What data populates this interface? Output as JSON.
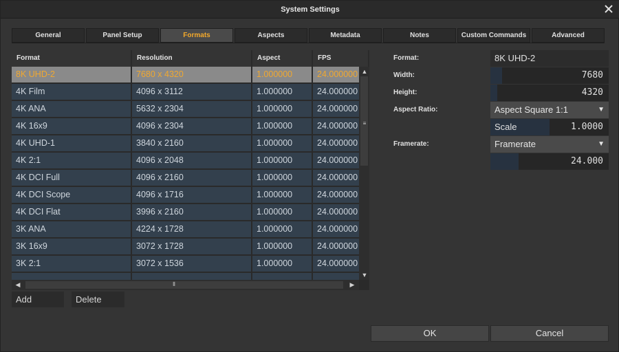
{
  "window": {
    "title": "System Settings"
  },
  "tabs": [
    {
      "label": "General",
      "active": false
    },
    {
      "label": "Panel Setup",
      "active": false
    },
    {
      "label": "Formats",
      "active": true
    },
    {
      "label": "Aspects",
      "active": false
    },
    {
      "label": "Metadata",
      "active": false
    },
    {
      "label": "Notes",
      "active": false
    },
    {
      "label": "Custom Commands",
      "active": false
    },
    {
      "label": "Advanced",
      "active": false
    }
  ],
  "table": {
    "columns": [
      "Format",
      "Resolution",
      "Aspect",
      "FPS"
    ],
    "selected_row": 0,
    "rows": [
      [
        "8K UHD-2",
        "7680 x 4320",
        "1.000000",
        "24.000000"
      ],
      [
        "4K Film",
        "4096 x 3112",
        "1.000000",
        "24.000000"
      ],
      [
        "4K ANA",
        "5632 x 2304",
        "1.000000",
        "24.000000"
      ],
      [
        "4K 16x9",
        "4096 x 2304",
        "1.000000",
        "24.000000"
      ],
      [
        "4K UHD-1",
        "3840 x 2160",
        "1.000000",
        "24.000000"
      ],
      [
        "4K 2:1",
        "4096 x 2048",
        "1.000000",
        "24.000000"
      ],
      [
        "4K DCI Full",
        "4096 x 2160",
        "1.000000",
        "24.000000"
      ],
      [
        "4K DCI Scope",
        "4096 x 1716",
        "1.000000",
        "24.000000"
      ],
      [
        "4K DCI Flat",
        "3996 x 2160",
        "1.000000",
        "24.000000"
      ],
      [
        "3K ANA",
        "4224 x 1728",
        "1.000000",
        "24.000000"
      ],
      [
        "3K 16x9",
        "3072 x 1728",
        "1.000000",
        "24.000000"
      ],
      [
        "3K 2:1",
        "3072 x 1536",
        "1.000000",
        "24.000000"
      ],
      [
        "",
        "",
        "",
        ""
      ]
    ]
  },
  "buttons": {
    "add": "Add",
    "delete": "Delete",
    "ok": "OK",
    "cancel": "Cancel"
  },
  "details": {
    "format_label": "Format:",
    "format_value": "8K UHD-2",
    "width_label": "Width:",
    "width_value": "7680",
    "width_fill": 0.1,
    "height_label": "Height:",
    "height_value": "4320",
    "height_fill": 0.06,
    "aspect_label": "Aspect Ratio:",
    "aspect_value": "Aspect Square 1:1",
    "scale_label": "Scale",
    "scale_value": "1.0000",
    "framerate_label": "Framerate:",
    "framerate_dropdown": "Framerate",
    "framerate_value": "24.000",
    "framerate_fill": 0.24
  },
  "colors": {
    "accent": "#f3a92b",
    "cell_bg": "#33404d",
    "selected_bg": "#8a8a8a"
  }
}
